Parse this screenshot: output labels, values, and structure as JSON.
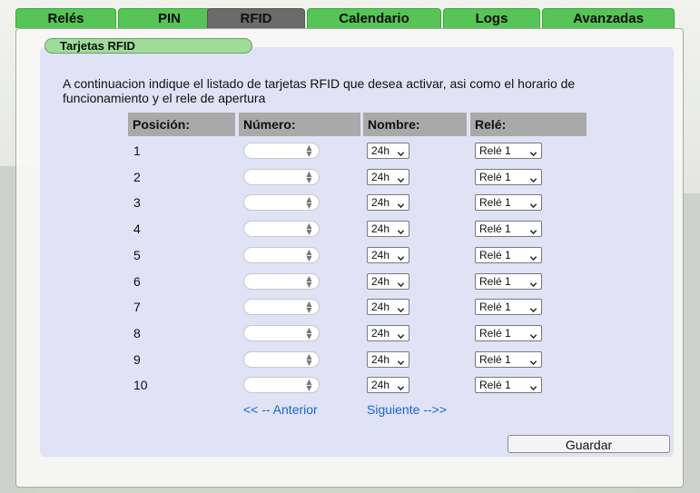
{
  "tabs": [
    {
      "label": "Relés",
      "active": false
    },
    {
      "label": "PIN",
      "active": false
    },
    {
      "label": "RFID",
      "active": true
    },
    {
      "label": "Calendario",
      "active": false
    },
    {
      "label": "Logs",
      "active": false
    },
    {
      "label": "Avanzadas",
      "active": false
    }
  ],
  "section": {
    "legend": "Tarjetas RFID",
    "intro": "A continuacion indique el listado de tarjetas RFID que desea activar, asi como el horario de funcionamiento y el rele de apertura"
  },
  "table": {
    "headers": [
      "Posición:",
      "Número:",
      "Nombre:",
      "Relé:"
    ],
    "rows": [
      {
        "position": "1",
        "number": "",
        "schedule": "24h",
        "relay": "Relé 1"
      },
      {
        "position": "2",
        "number": "",
        "schedule": "24h",
        "relay": "Relé 1"
      },
      {
        "position": "3",
        "number": "",
        "schedule": "24h",
        "relay": "Relé 1"
      },
      {
        "position": "4",
        "number": "",
        "schedule": "24h",
        "relay": "Relé 1"
      },
      {
        "position": "5",
        "number": "",
        "schedule": "24h",
        "relay": "Relé 1"
      },
      {
        "position": "6",
        "number": "",
        "schedule": "24h",
        "relay": "Relé 1"
      },
      {
        "position": "7",
        "number": "",
        "schedule": "24h",
        "relay": "Relé 1"
      },
      {
        "position": "8",
        "number": "",
        "schedule": "24h",
        "relay": "Relé 1"
      },
      {
        "position": "9",
        "number": "",
        "schedule": "24h",
        "relay": "Relé 1"
      },
      {
        "position": "10",
        "number": "",
        "schedule": "24h",
        "relay": "Relé 1"
      }
    ]
  },
  "pagination": {
    "prev_label": "<< -- Anterior",
    "next_label": "Siguiente -->>"
  },
  "actions": {
    "save_label": "Guardar"
  },
  "icons": {
    "select_caret": "chevron-down-icon",
    "number_spinner": "spinner-arrows-icon"
  },
  "colors": {
    "tab_green": "#56c456",
    "tab_active": "#6b6b6b",
    "legend_green": "#9fdc9a",
    "panel_lavender": "#dde0f5",
    "header_gray": "#a9a9a9",
    "link_blue": "#1a66cc"
  }
}
